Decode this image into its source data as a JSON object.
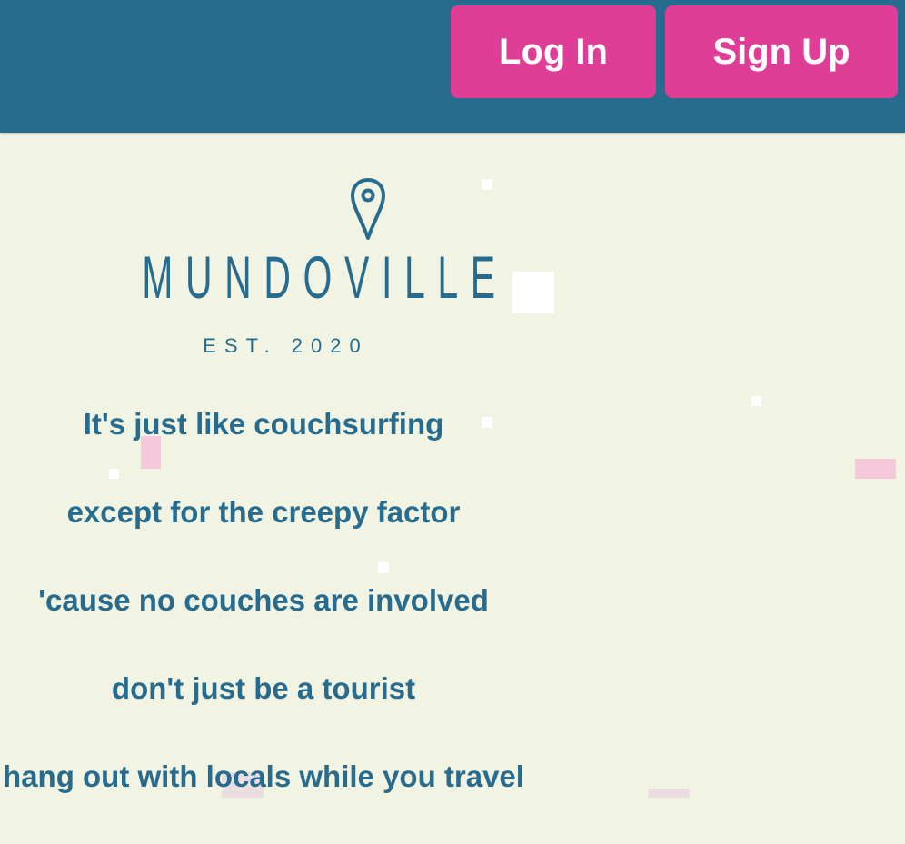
{
  "header": {
    "login_label": "Log In",
    "signup_label": "Sign Up"
  },
  "logo": {
    "brand": "MUNDOVILLE",
    "established": "EST. 2020",
    "icon": "map-pin-icon"
  },
  "taglines": [
    "It's just like couchsurfing",
    "except for the creepy factor",
    "'cause no couches are involved",
    "don't just be a tourist",
    "hang out with locals while you travel"
  ],
  "colors": {
    "header_bg": "#276C8F",
    "button_bg": "#DF3D96",
    "page_bg": "#F1F4E3",
    "text": "#276C8F",
    "confetti_white": "#FFFFFF",
    "confetti_pink": "#F6C9DA"
  }
}
